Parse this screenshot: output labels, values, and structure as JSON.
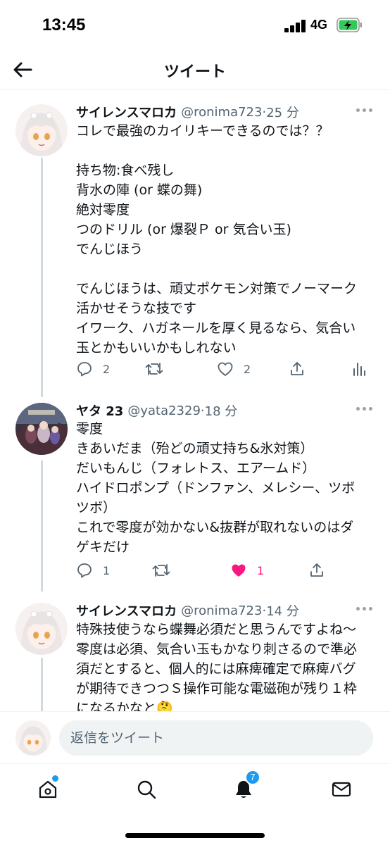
{
  "status_bar": {
    "time": "13:45",
    "network": "4G"
  },
  "header": {
    "title": "ツイート"
  },
  "tweets": [
    {
      "name": "サイレンスマロカ",
      "handle": "@ronima723",
      "time": "25 分",
      "lines": [
        "コレで最強のカイリキーできるのでは？？",
        "",
        "持ち物:食べ残し",
        "背水の陣 (or 蝶の舞)",
        "絶対零度",
        "つのドリル (or 爆裂Ｐ or 気合い玉)",
        "でんじほう",
        "",
        "でんじほうは、頑丈ポケモン対策でノーマーク",
        "活かせそうな技です",
        "イワーク、ハガネールを厚く見るなら、気合い",
        "玉とかもいいかもしれない"
      ],
      "reply_count": "2",
      "retweet_count": "",
      "like_count": "2"
    },
    {
      "name": "ヤタ 23",
      "handle": "@yata2329",
      "time": "18 分",
      "lines": [
        "零度",
        "きあいだま（殆どの頑丈持ち&氷対策）",
        "だいもんじ（フォレトス、エアームド）",
        "ハイドロポンプ（ドンファン、メレシー、ツボ",
        "ツボ）",
        "これで零度が効かない&抜群が取れないのはダ",
        "ゲキだけ"
      ],
      "reply_count": "1",
      "retweet_count": "",
      "like_count": "1",
      "liked": true,
      "like_color": "#f91880"
    },
    {
      "name": "サイレンスマロカ",
      "handle": "@ronima723",
      "time": "14 分",
      "lines": [
        "特殊技使うなら蝶舞必須だと思うんですよね〜",
        "零度は必須、気合い玉もかなり刺さるので準必",
        "須だとすると、個人的には麻痺確定で麻痺バグ",
        "が期待できつつＳ操作可能な電磁砲が残り１枠",
        "になるかなと🤔"
      ]
    }
  ],
  "reply_bar": {
    "placeholder": "返信をツイート"
  },
  "tab_bar": {
    "notifications_badge": "7"
  },
  "colors": {
    "accent": "#1d9bf0",
    "text": "#0f1419",
    "muted": "#536471",
    "like": "#f91880"
  }
}
